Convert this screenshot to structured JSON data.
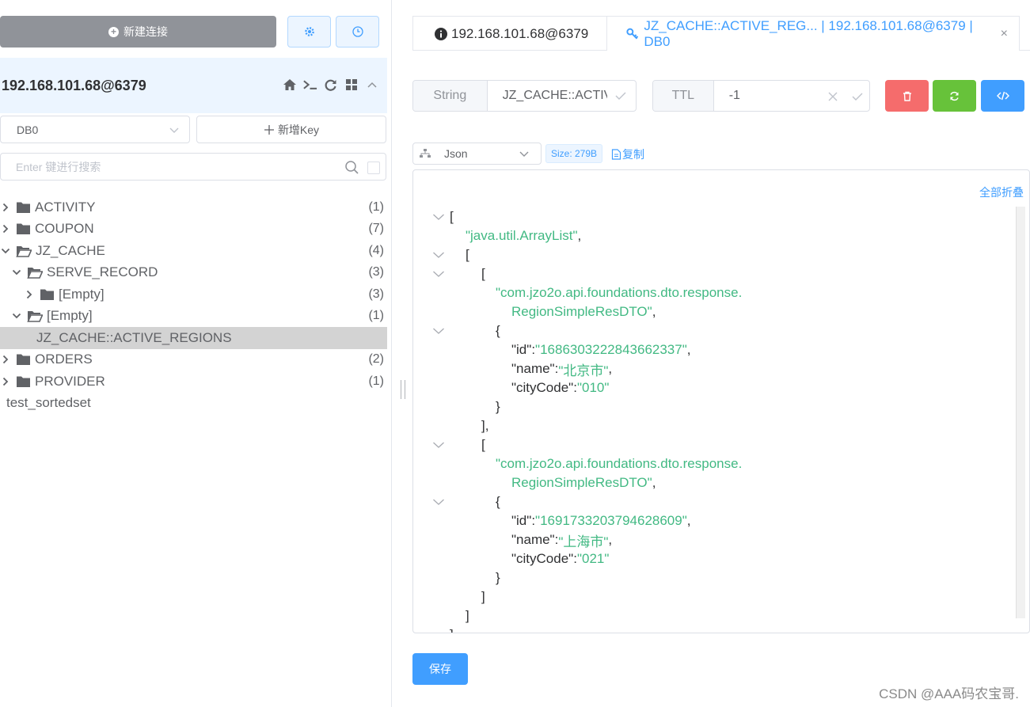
{
  "sidebar": {
    "new_connection_label": "新建连接",
    "connection": {
      "name": "192.168.101.68@6379"
    },
    "db_select": {
      "value": "DB0"
    },
    "add_key_label": "新增Key",
    "search": {
      "placeholder": "Enter 键进行搜索"
    },
    "tree": [
      {
        "label": "ACTIVITY",
        "count": "(1)",
        "level": 0,
        "expanded": false,
        "folder": true
      },
      {
        "label": "COUPON",
        "count": "(7)",
        "level": 0,
        "expanded": false,
        "folder": true
      },
      {
        "label": "JZ_CACHE",
        "count": "(4)",
        "level": 0,
        "expanded": true,
        "folder": true
      },
      {
        "label": "SERVE_RECORD",
        "count": "(3)",
        "level": 1,
        "expanded": true,
        "folder": true
      },
      {
        "label": "[Empty]",
        "count": "(3)",
        "level": 2,
        "expanded": false,
        "folder": true
      },
      {
        "label": "[Empty]",
        "count": "(1)",
        "level": 1,
        "expanded": true,
        "folder": true
      },
      {
        "label": "JZ_CACHE::ACTIVE_REGIONS",
        "count": "",
        "level": 2,
        "expanded": false,
        "folder": false,
        "selected": true
      },
      {
        "label": "ORDERS",
        "count": "(2)",
        "level": 0,
        "expanded": false,
        "folder": true
      },
      {
        "label": "PROVIDER",
        "count": "(1)",
        "level": 0,
        "expanded": false,
        "folder": true
      },
      {
        "label": "test_sortedset",
        "count": "",
        "level": 0,
        "expanded": false,
        "folder": false
      }
    ]
  },
  "tabs": [
    {
      "label": "192.168.101.68@6379",
      "icon": "info-icon"
    },
    {
      "label": "JZ_CACHE::ACTIVE_REG... | 192.168.101.68@6379 | DB0",
      "icon": "key-icon",
      "active": true
    }
  ],
  "key_bar": {
    "type": "String",
    "key_name": "JZ_CACHE::ACTIVE_REGIONS",
    "ttl_label": "TTL",
    "ttl_value": "-1"
  },
  "viewer": {
    "format": "Json",
    "size": "Size: 279B",
    "copy_label": "复制",
    "collapse_all_label": "全部折叠"
  },
  "json_lines": [
    {
      "fold": true,
      "parts": [
        [
          "p",
          "["
        ]
      ]
    },
    {
      "fold": false,
      "parts": [
        [
          "s",
          "\"java.util.ArrayList\""
        ],
        [
          "p",
          ","
        ]
      ]
    },
    {
      "fold": true,
      "parts": [
        [
          "p",
          "["
        ]
      ]
    },
    {
      "fold": true,
      "parts": [
        [
          "p",
          "["
        ]
      ]
    },
    {
      "fold": false,
      "parts": [
        [
          "s",
          "\"com.jzo2o.api.foundations.dto.response."
        ]
      ]
    },
    {
      "fold": false,
      "parts": [
        [
          "s",
          "RegionSimpleResDTO\""
        ],
        [
          "p",
          ","
        ]
      ]
    },
    {
      "fold": true,
      "parts": [
        [
          "p",
          "{"
        ]
      ]
    },
    {
      "fold": false,
      "parts": [
        [
          "k",
          "\"id\""
        ],
        [
          "p",
          ": "
        ],
        [
          "s",
          "\"1686303222843662337\""
        ],
        [
          "p",
          ","
        ]
      ]
    },
    {
      "fold": false,
      "parts": [
        [
          "k",
          "\"name\""
        ],
        [
          "p",
          ": "
        ],
        [
          "s",
          "\"北京市\""
        ],
        [
          "p",
          ","
        ]
      ]
    },
    {
      "fold": false,
      "parts": [
        [
          "k",
          "\"cityCode\""
        ],
        [
          "p",
          ": "
        ],
        [
          "s",
          "\"010\""
        ]
      ]
    },
    {
      "fold": false,
      "parts": [
        [
          "p",
          "}"
        ]
      ]
    },
    {
      "fold": false,
      "parts": [
        [
          "p",
          "],"
        ]
      ]
    },
    {
      "fold": true,
      "parts": [
        [
          "p",
          "["
        ]
      ]
    },
    {
      "fold": false,
      "parts": [
        [
          "s",
          "\"com.jzo2o.api.foundations.dto.response."
        ]
      ]
    },
    {
      "fold": false,
      "parts": [
        [
          "s",
          "RegionSimpleResDTO\""
        ],
        [
          "p",
          ","
        ]
      ]
    },
    {
      "fold": true,
      "parts": [
        [
          "p",
          "{"
        ]
      ]
    },
    {
      "fold": false,
      "parts": [
        [
          "k",
          "\"id\""
        ],
        [
          "p",
          ": "
        ],
        [
          "s",
          "\"1691733203794628609\""
        ],
        [
          "p",
          ","
        ]
      ]
    },
    {
      "fold": false,
      "parts": [
        [
          "k",
          "\"name\""
        ],
        [
          "p",
          ": "
        ],
        [
          "s",
          "\"上海市\""
        ],
        [
          "p",
          ","
        ]
      ]
    },
    {
      "fold": false,
      "parts": [
        [
          "k",
          "\"cityCode\""
        ],
        [
          "p",
          ": "
        ],
        [
          "s",
          "\"021\""
        ]
      ]
    },
    {
      "fold": false,
      "parts": [
        [
          "p",
          "}"
        ]
      ]
    },
    {
      "fold": false,
      "parts": [
        [
          "p",
          "]"
        ]
      ]
    },
    {
      "fold": false,
      "parts": [
        [
          "p",
          "]"
        ]
      ]
    },
    {
      "fold": false,
      "parts": [
        [
          "p",
          "]"
        ]
      ]
    }
  ],
  "save_label": "保存",
  "watermark": "CSDN @AAA码农宝哥.",
  "colors": {
    "primary": "#409eff",
    "danger": "#f56c6c",
    "success": "#67c23a",
    "json_string": "#42b983",
    "selected_row": "#d3d3d3"
  }
}
